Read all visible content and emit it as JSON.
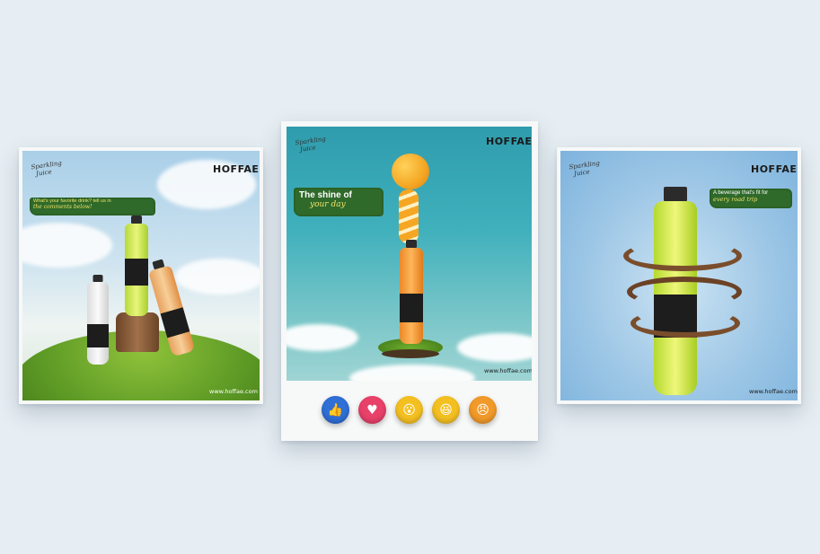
{
  "posts": [
    {
      "brand": "HOFFAE",
      "script_line1": "Sparkling",
      "script_line2": "Juice",
      "headline_line1": "What's your favorite drink? tell us in",
      "headline_line2": "the comments below!",
      "website": "www.hoffae.com"
    },
    {
      "brand": "HOFFAE",
      "script_line1": "Sparkling",
      "script_line2": "Juice",
      "headline_line1": "The shine of",
      "headline_line2": "your day",
      "website": "www.hoffae.com"
    },
    {
      "brand": "HOFFAE",
      "script_line1": "Sparkling",
      "script_line2": "Juice",
      "headline_line1": "A beverage that's fit for",
      "headline_line2": "every road trip",
      "website": "www.hoffae.com"
    }
  ],
  "reactions": [
    {
      "name": "like",
      "glyph": "👍",
      "color": "#2f6fd6"
    },
    {
      "name": "love",
      "glyph": "♥",
      "color": "#e8416a"
    },
    {
      "name": "wow",
      "glyph": "😮",
      "color": "#f4c021"
    },
    {
      "name": "haha",
      "glyph": "😆",
      "color": "#f4c021"
    },
    {
      "name": "angry",
      "glyph": "😠",
      "color": "#f19a2a"
    }
  ]
}
